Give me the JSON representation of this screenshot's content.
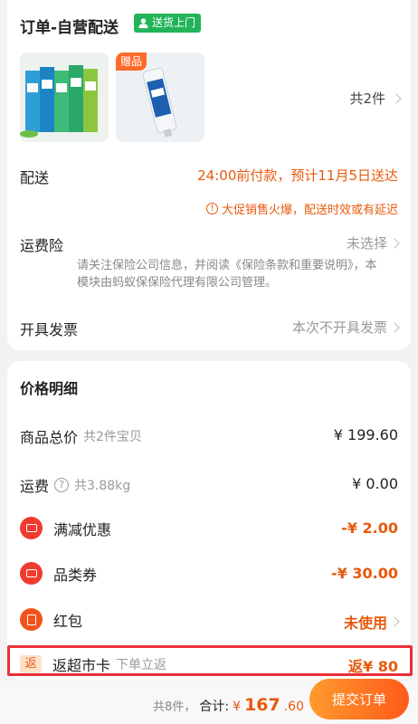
{
  "order": {
    "title": "订单-自营配送",
    "delivery_tag": "送货上门",
    "gift_badge": "赠品",
    "quantity": "共2件",
    "delivery_label": "配送",
    "delivery_time": "24:00前付款，预计11月5日送达",
    "delivery_warning": "大促销售火爆，配送时效或有延迟",
    "insurance_label": "运费险",
    "insurance_value": "未选择",
    "insurance_note": "请关注保险公司信息，并阅读《保险条款和重要说明》，本模块由蚂蚁保保险代理有限公司管理。",
    "invoice_label": "开具发票",
    "invoice_value": "本次不开具发票"
  },
  "price": {
    "title": "价格明细",
    "goods_label": "商品总价",
    "goods_sub": "共2件宝贝",
    "goods_value": "¥ 199.60",
    "shipping_label": "运费",
    "shipping_sub": "共3.88kg",
    "shipping_value": "¥ 0.00",
    "discount_label": "满减优惠",
    "discount_value": "-¥ 2.00",
    "coupon_label": "品类券",
    "coupon_value": "-¥ 30.00",
    "redpacket_label": "红包",
    "redpacket_value": "未使用",
    "cashback_badge": "返",
    "cashback_label": "返超市卡",
    "cashback_sub": "下单立返",
    "cashback_value": "返¥ 80"
  },
  "footer": {
    "count": "共8件，",
    "total_label": "合计:",
    "yen": "¥",
    "total_int": "167",
    "total_dec": ".60",
    "submit_label": "提交订单"
  },
  "colors": {
    "accent": "#e8590c",
    "delivery_tag": "#23b45a",
    "highlight_box": "#e8303a"
  }
}
